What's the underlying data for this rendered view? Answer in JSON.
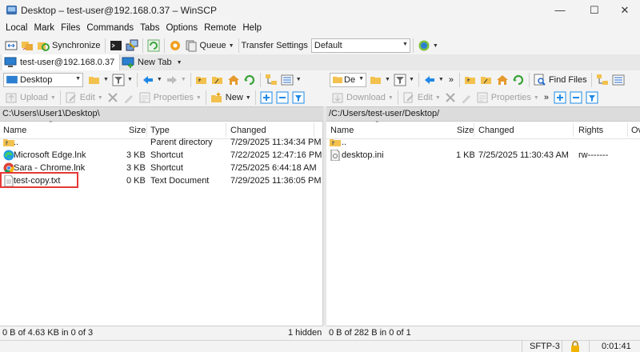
{
  "window": {
    "title": "Desktop – test-user@192.168.0.37 – WinSCP",
    "controls": {
      "minimize": "—",
      "maximize": "☐",
      "close": "✕"
    }
  },
  "menu": [
    "Local",
    "Mark",
    "Files",
    "Commands",
    "Tabs",
    "Options",
    "Remote",
    "Help"
  ],
  "toolbar1": {
    "synchronize": "Synchronize",
    "queue": "Queue",
    "transfer_settings_label": "Transfer Settings",
    "transfer_settings_value": "Default"
  },
  "tabs": {
    "session": "test-user@192.168.0.37",
    "new_tab": "New Tab"
  },
  "local": {
    "drive": "Desktop",
    "upload": "Upload",
    "edit": "Edit",
    "properties": "Properties",
    "new": "New",
    "path": "C:\\Users\\User1\\Desktop\\",
    "columns": {
      "name": "Name",
      "size": "Size",
      "type": "Type",
      "changed": "Changed"
    },
    "files": [
      {
        "name": "..",
        "size": "",
        "type": "Parent directory",
        "changed": "7/29/2025 11:34:34 PM",
        "icon": "parent-folder-icon"
      },
      {
        "name": "Microsoft Edge.lnk",
        "size": "3 KB",
        "type": "Shortcut",
        "changed": "7/22/2025 12:47:16 PM",
        "icon": "edge-icon"
      },
      {
        "name": "Sara - Chrome.lnk",
        "size": "3 KB",
        "type": "Shortcut",
        "changed": "7/25/2025 6:44:18 AM",
        "icon": "chrome-icon"
      },
      {
        "name": "test-copy.txt",
        "size": "0 KB",
        "type": "Text Document",
        "changed": "7/29/2025 11:36:05 PM",
        "icon": "text-file-icon"
      }
    ],
    "status_left": "0 B of 4.63 KB in 0 of 3",
    "status_right": "1 hidden"
  },
  "remote": {
    "drive": "De",
    "download": "Download",
    "edit": "Edit",
    "properties": "Properties",
    "find_files": "Find Files",
    "path": "/C:/Users/test-user/Desktop/",
    "columns": {
      "name": "Name",
      "size": "Size",
      "changed": "Changed",
      "rights": "Rights",
      "owner": "Ov"
    },
    "files": [
      {
        "name": "..",
        "size": "",
        "changed": "",
        "rights": "",
        "icon": "parent-folder-icon"
      },
      {
        "name": "desktop.ini",
        "size": "1 KB",
        "changed": "7/25/2025 11:30:43 AM",
        "rights": "rw-------",
        "icon": "ini-file-icon"
      }
    ],
    "status_left": "0 B of 282 B in 0 of 1"
  },
  "statusbar": {
    "protocol": "SFTP-3",
    "time": "0:01:41"
  },
  "colors": {
    "highlight": "#e53935",
    "accent_blue": "#1e88e5",
    "folder_yellow": "#f2c14e",
    "green": "#3aa43a"
  }
}
